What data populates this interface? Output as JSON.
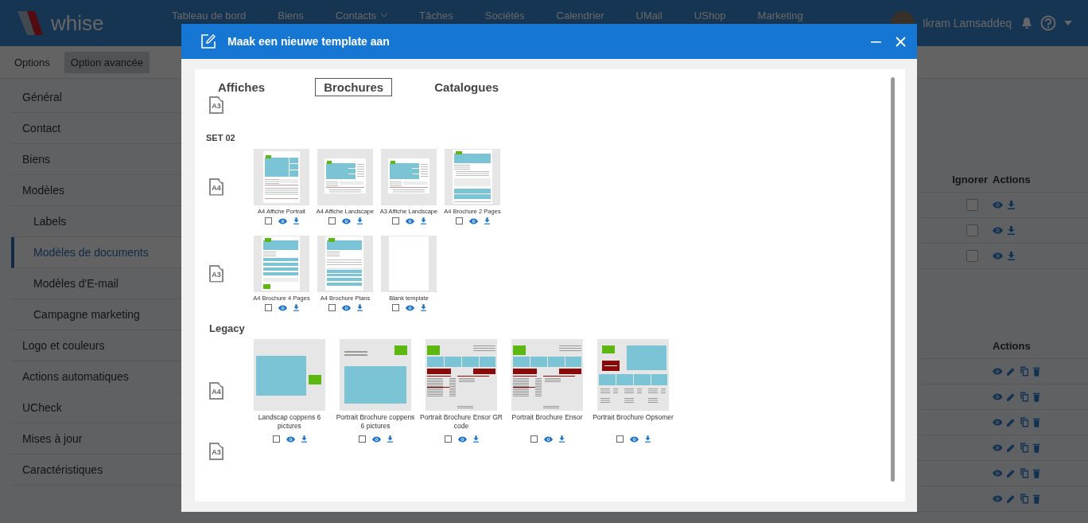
{
  "nav": {
    "logo": "whise",
    "items": [
      {
        "label": "Tableau de bord",
        "has_menu": false
      },
      {
        "label": "Biens",
        "has_menu": false
      },
      {
        "label": "Contacts",
        "has_menu": true
      },
      {
        "label": "Tâches",
        "has_menu": false
      },
      {
        "label": "Sociétés",
        "has_menu": false
      },
      {
        "label": "Calendrier",
        "has_menu": false
      },
      {
        "label": "UMail",
        "has_menu": false
      },
      {
        "label": "UShop",
        "has_menu": false
      },
      {
        "label": "Marketing",
        "has_menu": false
      }
    ],
    "user": "Ikram Lamsaddeq"
  },
  "toolbar": [
    {
      "label": "Options",
      "selected": false
    },
    {
      "label": "Option avancée",
      "selected": true
    }
  ],
  "sidebar": {
    "items": [
      {
        "label": "Général",
        "selected": false
      },
      {
        "label": "Contact",
        "selected": false
      },
      {
        "label": "Biens",
        "selected": false
      },
      {
        "label": "Modèles",
        "selected": false,
        "children": [
          {
            "label": "Labels",
            "selected": false
          },
          {
            "label": "Modèles de documents",
            "selected": true
          },
          {
            "label": "Modèles d'E-mail",
            "selected": false
          },
          {
            "label": "Campagne marketing",
            "selected": false
          }
        ]
      },
      {
        "label": "Logo et couleurs",
        "selected": false
      },
      {
        "label": "Actions automatiques",
        "selected": false
      },
      {
        "label": "UCheck",
        "selected": false
      },
      {
        "label": "Mises à jour",
        "selected": false
      },
      {
        "label": "Caractéristiques",
        "selected": false
      }
    ]
  },
  "tables": [
    {
      "columns": [
        "Ignorer",
        "Actions"
      ],
      "rows": [
        {
          "ignored": false,
          "actions": [
            {
              "kind": "view"
            },
            {
              "kind": "download"
            }
          ]
        },
        {
          "ignored": false,
          "actions": [
            {
              "kind": "view"
            },
            {
              "kind": "download"
            }
          ]
        },
        {
          "ignored": false,
          "actions": [
            {
              "kind": "view"
            },
            {
              "kind": "download"
            }
          ]
        }
      ]
    },
    {
      "columns": [
        "Actions"
      ],
      "rows": [
        {
          "actions": [
            {
              "kind": "view"
            },
            {
              "kind": "edit"
            },
            {
              "kind": "copy"
            },
            {
              "kind": "delete"
            }
          ]
        },
        {
          "actions": [
            {
              "kind": "view"
            },
            {
              "kind": "edit"
            },
            {
              "kind": "copy"
            },
            {
              "kind": "delete"
            }
          ]
        },
        {
          "actions": [
            {
              "kind": "view"
            },
            {
              "kind": "edit"
            },
            {
              "kind": "copy"
            },
            {
              "kind": "delete"
            }
          ]
        },
        {
          "actions": [
            {
              "kind": "view"
            },
            {
              "kind": "edit"
            },
            {
              "kind": "copy"
            },
            {
              "kind": "delete"
            }
          ]
        },
        {
          "actions": [
            {
              "kind": "view"
            },
            {
              "kind": "edit"
            },
            {
              "kind": "copy"
            },
            {
              "kind": "delete"
            }
          ]
        },
        {
          "actions": [
            {
              "kind": "view"
            },
            {
              "kind": "edit"
            },
            {
              "kind": "copy"
            },
            {
              "kind": "delete"
            }
          ]
        }
      ]
    }
  ],
  "modal": {
    "title": "Maak een nieuwe template aan",
    "tabs": [
      {
        "label": "Affiches",
        "selected": false
      },
      {
        "label": "Brochures",
        "selected": true
      },
      {
        "label": "Catalogues",
        "selected": false
      }
    ],
    "sections": [
      {
        "formats": [
          {
            "format": "A3"
          }
        ]
      },
      {
        "heading": "SET 02",
        "kind": "small",
        "formats": [
          {
            "format": "A4",
            "templates": [
              {
                "name": "A4 Affiche Portrait",
                "kind": "portrait",
                "checked": false
              },
              {
                "name": "A4 Affiche Landscape",
                "kind": "landscape",
                "checked": false
              },
              {
                "name": "A3 Affiche Landscape",
                "kind": "landscape",
                "checked": false
              },
              {
                "name": "A4 Brochure 2 Pages",
                "kind": "brochure2",
                "checked": false
              }
            ]
          },
          {
            "format": "A3",
            "templates": [
              {
                "name": "A4 Brochure 4 Pages",
                "kind": "brochure4",
                "checked": false
              },
              {
                "name": "A4 Brochure Plans",
                "kind": "plans",
                "checked": false
              },
              {
                "name": "Blank template",
                "kind": "blank",
                "checked": false
              }
            ]
          }
        ]
      },
      {
        "heading": "Legacy",
        "kind": "large",
        "formats": [
          {
            "format": "A4",
            "templates": [
              {
                "name": "Landscap coppens 6 pictures",
                "kind": "coppens-landscape",
                "checked": false
              },
              {
                "name": "Portrait Brochure coppens 6 pictures",
                "kind": "coppens-portrait",
                "checked": false
              },
              {
                "name": "Portrait Brochure Ensor GR code",
                "kind": "ensor",
                "checked": false
              },
              {
                "name": "Portrait Brochure Ensor",
                "kind": "ensor",
                "checked": false
              },
              {
                "name": "Portrait Brochure Opsomer",
                "kind": "opsomer",
                "checked": false
              }
            ]
          },
          {
            "format": "A3"
          }
        ]
      }
    ]
  }
}
